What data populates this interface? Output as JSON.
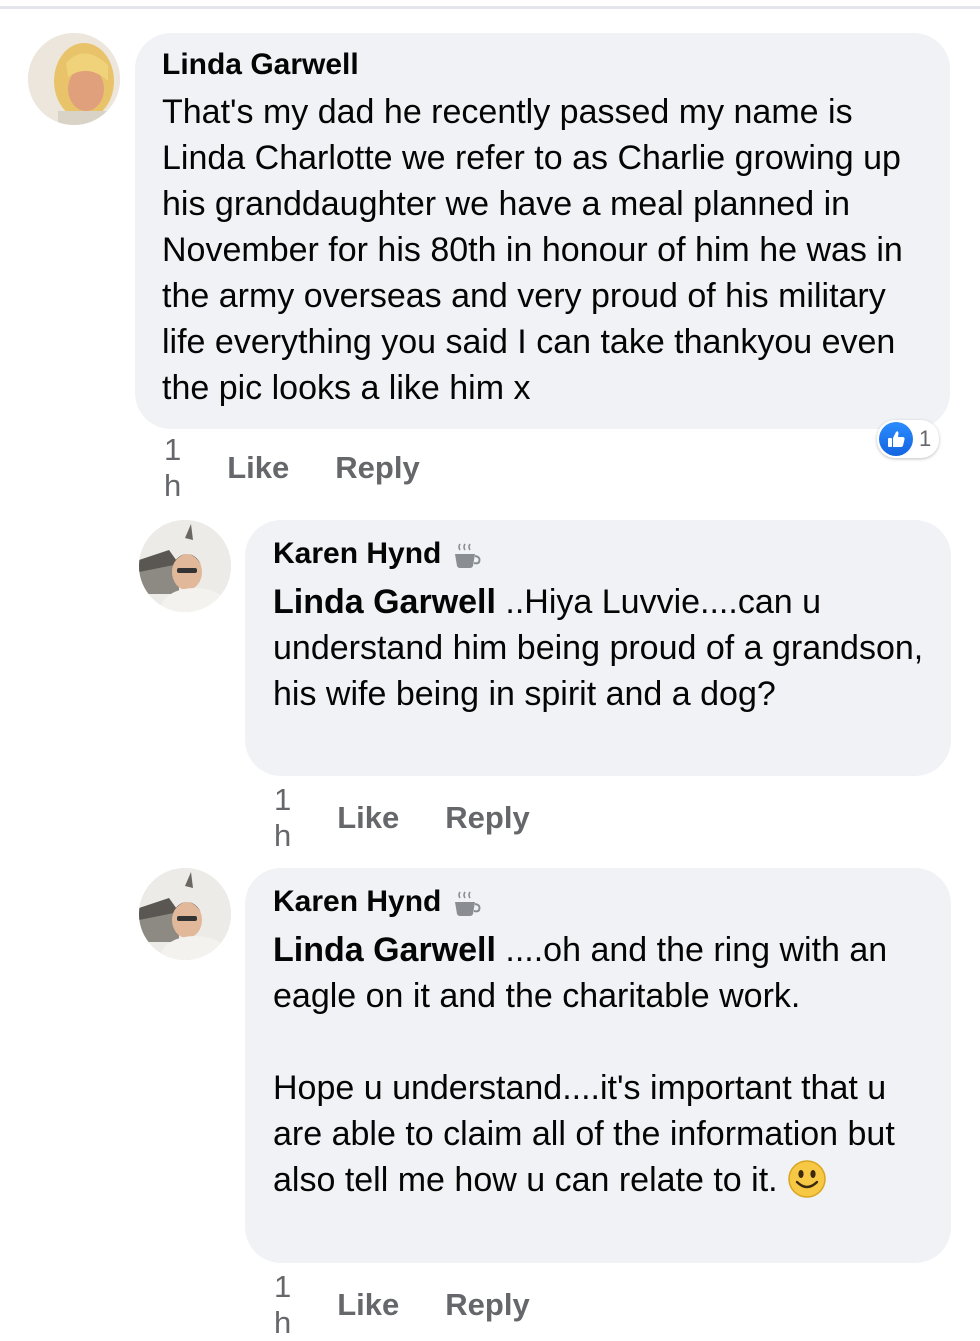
{
  "comments": [
    {
      "author": "Linda Garwell",
      "text": "That's my dad he recently passed my name is Linda Charlotte we refer to as Charlie growing up his granddaughter we have a meal planned in November for his 80th in honour of him he was in the army overseas and very proud of his military life everything you said I can take thankyou even the pic looks a like him x",
      "time": "1 h",
      "like_label": "Like",
      "reply_label": "Reply",
      "reaction_count": "1"
    },
    {
      "author": "Karen Hynd",
      "mention": "Linda Garwell",
      "text": " ..Hiya Luvvie....can u understand him being proud of a grandson, his wife being in spirit and a dog?",
      "time": "1 h",
      "like_label": "Like",
      "reply_label": "Reply"
    },
    {
      "author": "Karen Hynd",
      "mention": "Linda Garwell",
      "text": " ....oh and the ring with an eagle on it and the charitable work.\n\nHope u understand....it's important that u are able to claim all of the information but also tell me how u can relate to it. ",
      "time": "1 h",
      "like_label": "Like",
      "reply_label": "Reply"
    }
  ],
  "colors": {
    "bubble": "#f0f2f5",
    "action_text": "#65676b",
    "like_blue": "#1877f2"
  },
  "icons": {
    "reaction": "like-thumb-icon",
    "badge": "coffee-cup-icon",
    "emoji": "smiley-emoji-icon"
  }
}
